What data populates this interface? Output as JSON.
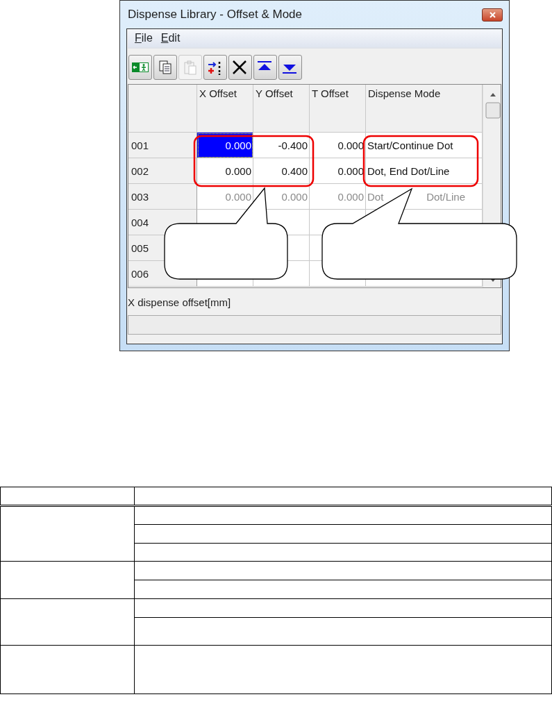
{
  "window": {
    "title": "Dispense Library - Offset & Mode"
  },
  "menu": [
    {
      "label": "File"
    },
    {
      "label": "Edit"
    }
  ],
  "toolbar": [
    {
      "kind": "exit",
      "disabled": false
    },
    {
      "kind": "copy",
      "disabled": false
    },
    {
      "kind": "paste",
      "disabled": true
    },
    {
      "kind": "insert",
      "disabled": false
    },
    {
      "kind": "delete",
      "disabled": false
    },
    {
      "kind": "top",
      "disabled": false
    },
    {
      "kind": "bottom",
      "disabled": false
    }
  ],
  "table": {
    "columns": [
      "X Offset",
      "Y Offset",
      "T Offset",
      "Dispense Mode"
    ],
    "rows": [
      {
        "number": "001",
        "enabled": true,
        "cells": [
          {
            "text": "0.000",
            "selected": true
          },
          {
            "text": "-0.400",
            "selected": false
          },
          {
            "text": "0.000",
            "selected": false
          },
          {
            "text": "Start/Continue Dot",
            "selected": false
          }
        ]
      },
      {
        "number": "002",
        "enabled": true,
        "cells": [
          {
            "text": "0.000",
            "selected": false
          },
          {
            "text": "0.400",
            "selected": false
          },
          {
            "text": "0.000",
            "selected": false
          },
          {
            "text": "Dot, End Dot/Line",
            "selected": false
          }
        ]
      },
      {
        "number": "003",
        "enabled": false,
        "cells": [
          {
            "text": "0.000",
            "selected": false
          },
          {
            "text": "0.000",
            "selected": false
          },
          {
            "text": "0.000",
            "selected": false
          },
          {
            "parts": [
              "Dot",
              "Dot/Line"
            ],
            "selected": false
          }
        ]
      },
      {
        "number": "004"
      },
      {
        "number": "005"
      },
      {
        "number": "006"
      }
    ]
  },
  "status_bar": {
    "text": "X dispense offset[mm]"
  }
}
